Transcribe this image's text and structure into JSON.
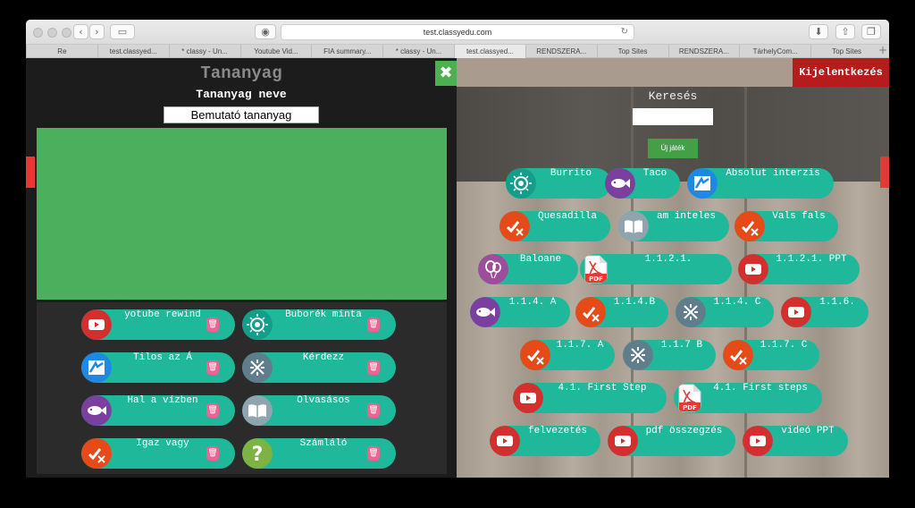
{
  "browser": {
    "url": "test.classyedu.com",
    "tabs": [
      "Re",
      "test.classyed...",
      "* classy - Un...",
      "Youtube Vid...",
      "FIA summary...",
      "* classy - Un...",
      "test.classyed...",
      "RENDSZERA...",
      "Top Sites",
      "RENDSZERA...",
      "TárhelyCom...",
      "Top Sites"
    ],
    "active_tab": 6,
    "new_tab": "+"
  },
  "left": {
    "title": "Tananyag",
    "name_label": "Tananyag neve",
    "name_value": "Bemutató tananyag",
    "close": "✖",
    "items": [
      {
        "label": "yotube rewind",
        "icon": "youtube-icon"
      },
      {
        "label": "Buborék minta",
        "icon": "bubble-icon"
      },
      {
        "label": "Tilos az Á",
        "icon": "forbidden-icon"
      },
      {
        "label": "Kérdezz",
        "icon": "cross-arrows-icon"
      },
      {
        "label": "Hal a vízben",
        "icon": "fish-icon"
      },
      {
        "label": "Olvasásos",
        "icon": "book-icon"
      },
      {
        "label": "Igaz vagy",
        "icon": "true-false-icon"
      },
      {
        "label": "Számláló",
        "icon": "question-icon"
      }
    ],
    "trash": "🗑"
  },
  "right": {
    "logout": "Kijelentkezés",
    "search_label": "Keresés",
    "search_value": "",
    "new_game": "Új játék",
    "games": [
      {
        "label": "Burrito",
        "icon": "bubble-icon"
      },
      {
        "label": "Taco",
        "icon": "fish-icon"
      },
      {
        "label": "Absolut interzis",
        "icon": "forbidden-icon"
      },
      {
        "label": "Quesadilla",
        "icon": "true-false-icon"
      },
      {
        "label": "am inteles",
        "icon": "book-icon"
      },
      {
        "label": "Vals fals",
        "icon": "true-false-icon"
      },
      {
        "label": "Baloane",
        "icon": "balloon-icon"
      },
      {
        "label": "1.1.2.1.",
        "icon": "pdf-icon"
      },
      {
        "label": "1.1.2.1. PPT",
        "icon": "youtube-icon"
      },
      {
        "label": "1.1.4. A",
        "icon": "fish-icon"
      },
      {
        "label": "1.1.4.B",
        "icon": "true-false-icon"
      },
      {
        "label": "1.1.4. C",
        "icon": "cross-arrows-icon"
      },
      {
        "label": "1.1.6.",
        "icon": "youtube-icon"
      },
      {
        "label": "1.1.7. A",
        "icon": "true-false-icon"
      },
      {
        "label": "1.1.7 B",
        "icon": "cross-arrows-icon"
      },
      {
        "label": "1.1.7. C",
        "icon": "true-false-icon"
      },
      {
        "label": "4.1. First Step",
        "icon": "youtube-icon"
      },
      {
        "label": "4.1. First steps",
        "icon": "pdf-icon"
      },
      {
        "label": "felvezetés",
        "icon": "youtube-icon"
      },
      {
        "label": "pdf összegzés",
        "icon": "youtube-icon"
      },
      {
        "label": "videó PPT",
        "icon": "youtube-icon"
      }
    ]
  },
  "colors": {
    "accent": "#1fb89a",
    "youtube": "#d32f2f",
    "bubble": "#139e8c",
    "forbidden": "#1e88e5",
    "fish": "#7b3fa0",
    "true_false": "#e64a19",
    "book": "#90a4ae",
    "cross": "#607d8b",
    "question": "#7cb342",
    "balloon": "#9c4d9c",
    "pdf": "#e53935"
  }
}
